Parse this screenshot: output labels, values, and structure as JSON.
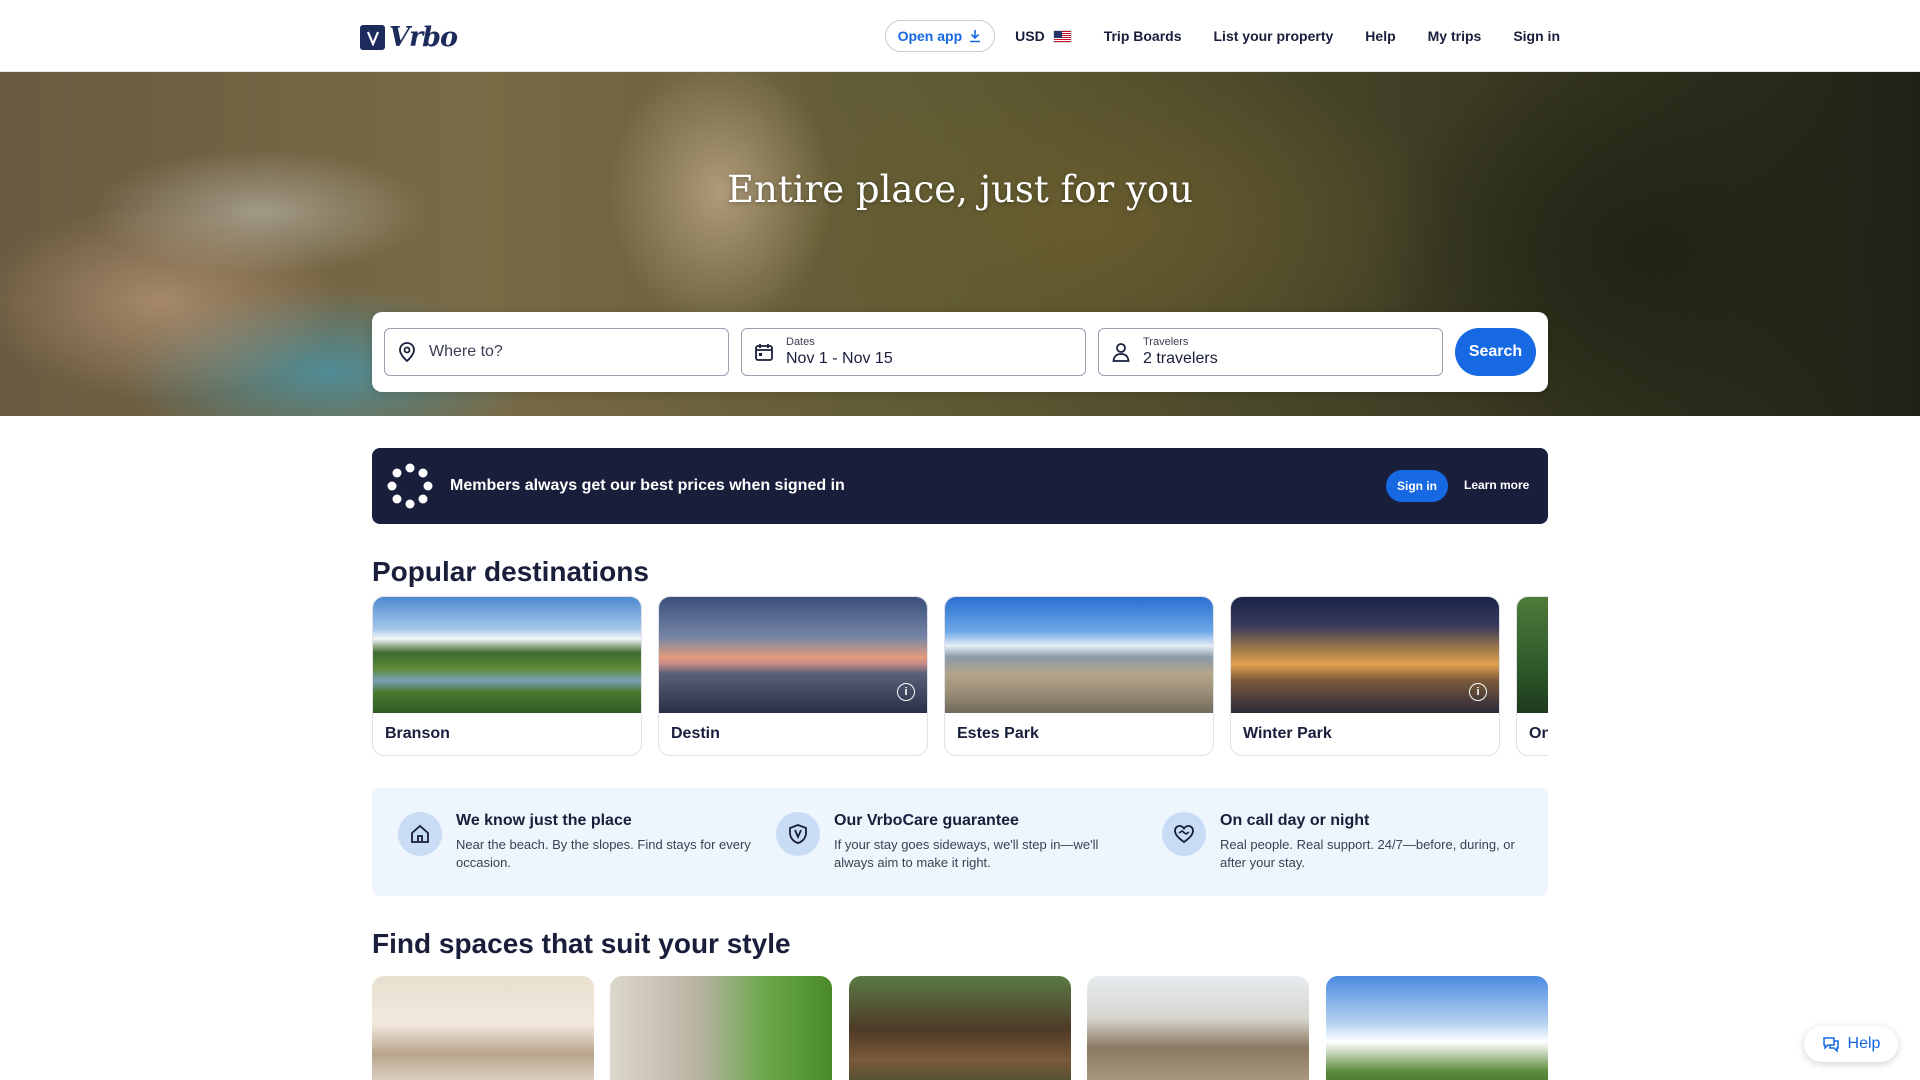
{
  "header": {
    "logo_text": "Vrbo",
    "open_app_label": "Open app",
    "currency_label": "USD",
    "nav": [
      "Trip Boards",
      "List your property",
      "Help",
      "My trips",
      "Sign in"
    ]
  },
  "hero": {
    "title": "Entire place, just for you",
    "search": {
      "destination_placeholder": "Where to?",
      "dates_label": "Dates",
      "dates_value": "Nov 1 - Nov 15",
      "travelers_label": "Travelers",
      "travelers_value": "2 travelers",
      "search_label": "Search"
    }
  },
  "member_banner": {
    "text": "Members always get our best prices when signed in",
    "sign_in_label": "Sign in",
    "learn_more_label": "Learn more"
  },
  "popular_destinations": {
    "title": "Popular destinations",
    "items": [
      {
        "name": "Branson"
      },
      {
        "name": "Destin"
      },
      {
        "name": "Estes Park"
      },
      {
        "name": "Winter Park"
      },
      {
        "name": "On"
      }
    ]
  },
  "perks": [
    {
      "title": "We know just the place",
      "desc": "Near the beach. By the slopes. Find stays for every occasion.",
      "icon": "house-icon"
    },
    {
      "title": "Our VrboCare guarantee",
      "desc": "If your stay goes sideways, we'll step in—we'll always aim to make it right.",
      "icon": "shield-icon"
    },
    {
      "title": "On call day or night",
      "desc": "Real people. Real support. 24/7—before, during, or after your stay.",
      "icon": "heart-handshake-icon"
    }
  ],
  "find_spaces": {
    "title": "Find spaces that suit your style"
  },
  "help_float": {
    "label": "Help"
  },
  "colors": {
    "brand_navy": "#191e3b",
    "accent_blue": "#1668e3",
    "perk_bg": "#eef5fd"
  }
}
